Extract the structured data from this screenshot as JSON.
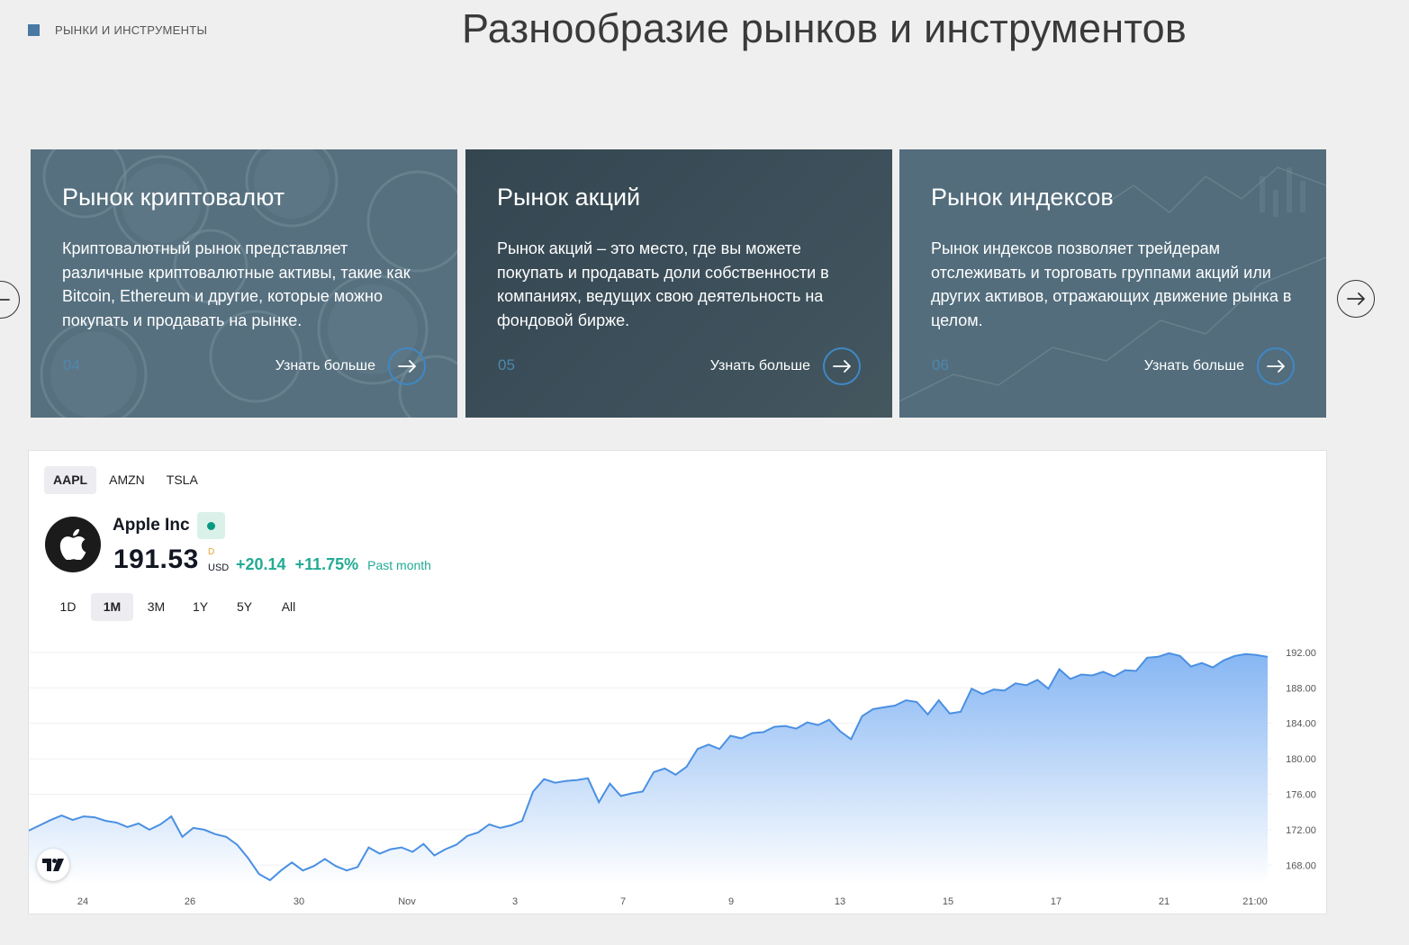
{
  "section": {
    "tag": "РЫНКИ И ИНСТРУМЕНТЫ",
    "title": "Разнообразие рынков и инструментов"
  },
  "cards": [
    {
      "title": "Рынок криптовалют",
      "text": "Криптовалютный рынок представляет различные криптовалютные активы, такие как Bitcoin, Ethereum и другие, которые можно покупать и продавать на рынке.",
      "number": "04",
      "more": "Узнать больше"
    },
    {
      "title": "Рынок акций",
      "text": "Рынок акций – это место, где вы можете покупать и продавать доли собственности в компаниях, ведущих свою деятельность на фондовой бирже.",
      "number": "05",
      "more": "Узнать больше"
    },
    {
      "title": "Рынок индексов",
      "text": "Рынок индексов позволяет трейдерам отслеживать и торговать группами акций или других активов, отражающих движение рынка в целом.",
      "number": "06",
      "more": "Узнать больше"
    }
  ],
  "widget": {
    "tabs": [
      "AAPL",
      "AMZN",
      "TSLA"
    ],
    "active_tab": "AAPL",
    "company": "Apple Inc",
    "price": "191.53",
    "price_flag": "D",
    "currency": "USD",
    "change_abs": "+20.14",
    "change_pct": "+11.75%",
    "period": "Past month",
    "ranges": [
      "1D",
      "1M",
      "3M",
      "1Y",
      "5Y",
      "All"
    ],
    "active_range": "1M"
  },
  "colors": {
    "accent": "#3f88c5",
    "positive": "#22ab94",
    "line": "#4a90e2",
    "card_dark": "#344650",
    "card_light": "#56707f"
  },
  "chart_data": {
    "type": "area",
    "ylim": [
      166,
      193
    ],
    "y_ticks": [
      "192.00",
      "188.00",
      "184.00",
      "180.00",
      "176.00",
      "172.00",
      "168.00"
    ],
    "x_ticks": [
      "24",
      "26",
      "30",
      "Nov",
      "3",
      "7",
      "9",
      "13",
      "15",
      "17",
      "21",
      "21:00"
    ],
    "grid": true,
    "series": [
      {
        "values": [
          171.9,
          172.5,
          173.1,
          173.6,
          173.1,
          173.5,
          173.4,
          173.0,
          172.8,
          172.3,
          172.7,
          172.0,
          172.6,
          173.5,
          171.2,
          172.2,
          172.0,
          171.5,
          171.2,
          170.3,
          168.8,
          167.0,
          166.3,
          167.4,
          168.3,
          167.4,
          167.9,
          168.7,
          167.9,
          167.4,
          167.8,
          170.0,
          169.3,
          169.8,
          170.0,
          169.5,
          170.4,
          169.1,
          169.8,
          170.3,
          171.3,
          171.7,
          172.6,
          172.2,
          172.5,
          173.0,
          176.3,
          177.7,
          177.3,
          177.5,
          177.6,
          177.8,
          175.1,
          177.2,
          175.8,
          176.1,
          176.3,
          178.5,
          178.9,
          178.2,
          179.1,
          181.1,
          181.6,
          181.1,
          182.6,
          182.3,
          182.9,
          183.0,
          183.6,
          183.7,
          183.4,
          184.1,
          183.8,
          184.4,
          183.1,
          182.2,
          184.8,
          185.6,
          185.8,
          186.0,
          186.6,
          186.4,
          185.0,
          186.6,
          185.1,
          185.3,
          187.9,
          187.3,
          187.8,
          187.7,
          188.5,
          188.3,
          188.9,
          187.9,
          190.1,
          189.0,
          189.5,
          189.4,
          189.8,
          189.3,
          190.0,
          189.9,
          191.4,
          191.5,
          191.9,
          191.6,
          190.4,
          190.8,
          190.3,
          191.1,
          191.6,
          191.8,
          191.7,
          191.5
        ]
      }
    ]
  }
}
